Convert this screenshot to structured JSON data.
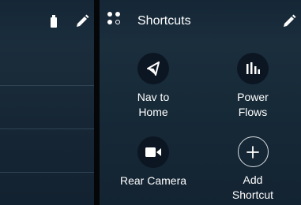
{
  "right_panel": {
    "title": "Shortcuts",
    "shortcuts": [
      {
        "label": "Nav to\nHome",
        "icon": "navigation-arrow-icon"
      },
      {
        "label": "Power\nFlows",
        "icon": "bar-chart-icon"
      },
      {
        "label": "Rear Camera",
        "icon": "video-camera-icon"
      },
      {
        "label": "Add\nShortcut",
        "icon": "plus-icon"
      }
    ]
  },
  "left_panel": {
    "icons": [
      "battery-icon",
      "pencil-icon"
    ]
  },
  "colors": {
    "panel_bg": "#1a2d3c",
    "header_bg": "#152736",
    "icon_circle": "#0c1622",
    "text": "#ffffff",
    "divider": "#050607"
  }
}
